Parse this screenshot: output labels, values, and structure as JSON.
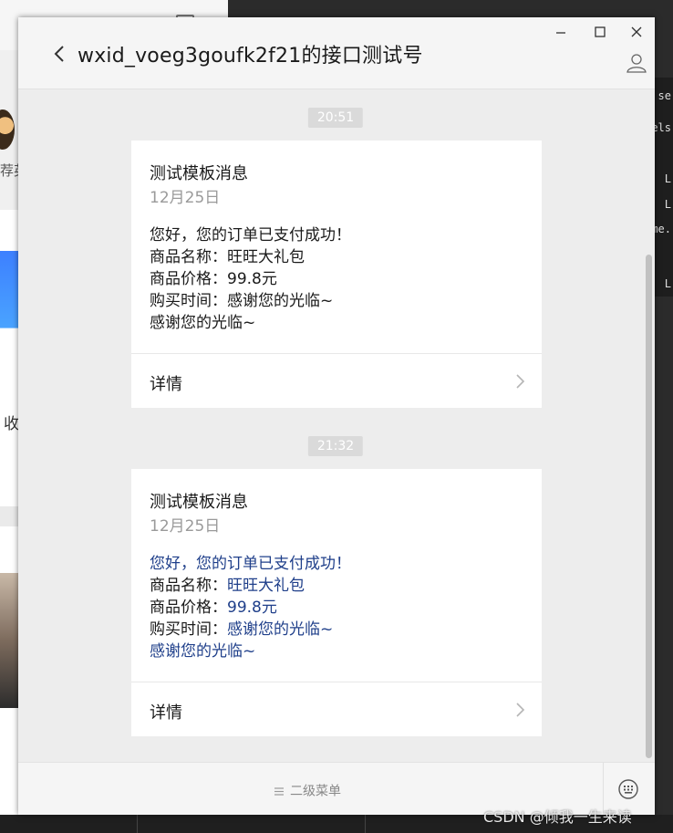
{
  "background": {
    "left_snippet_1": "荐英",
    "left_snippet_2": "收",
    "right_snippets": [
      "se",
      "vels",
      "L",
      "L",
      "me.",
      "L"
    ]
  },
  "window": {
    "title": "wxid_voeg3goufk2f21的接口测试号",
    "controls": {
      "minimize_icon": "minimize-icon",
      "maximize_icon": "maximize-icon",
      "close_icon": "close-icon"
    },
    "contact_icon": "person-icon",
    "back_icon": "chevron-left-icon"
  },
  "messages": [
    {
      "time": "20:51",
      "title": "测试模板消息",
      "date": "12月25日",
      "lines": [
        {
          "label": "",
          "value": "您好，您的订单已支付成功！"
        },
        {
          "label": "商品名称：",
          "value": "旺旺大礼包"
        },
        {
          "label": "商品价格：",
          "value": "99.8元"
        },
        {
          "label": "购买时间：",
          "value": "感谢您的光临~"
        },
        {
          "label": "",
          "value": "感谢您的光临~"
        }
      ],
      "value_color": "#1a1a1a",
      "detail_label": "详情"
    },
    {
      "time": "21:32",
      "title": "测试模板消息",
      "date": "12月25日",
      "lines": [
        {
          "label": "",
          "value": "您好，您的订单已支付成功！"
        },
        {
          "label": "商品名称：",
          "value": "旺旺大礼包"
        },
        {
          "label": "商品价格：",
          "value": "99.8元"
        },
        {
          "label": "购买时间：",
          "value": "感谢您的光临~"
        },
        {
          "label": "",
          "value": "感谢您的光临~"
        }
      ],
      "value_color": "#1f3f8a",
      "detail_label": "详情"
    }
  ],
  "bottom_bar": {
    "menu_label": "二级菜单",
    "menu_icon": "menu-lines-icon",
    "keyboard_icon": "keyboard-icon"
  },
  "watermark": "CSDN @倾我一生来读",
  "colors": {
    "window_bg": "#ededed",
    "card_bg": "#ffffff",
    "time_badge_bg": "#dadada",
    "link_blue": "#1f3f8a"
  }
}
